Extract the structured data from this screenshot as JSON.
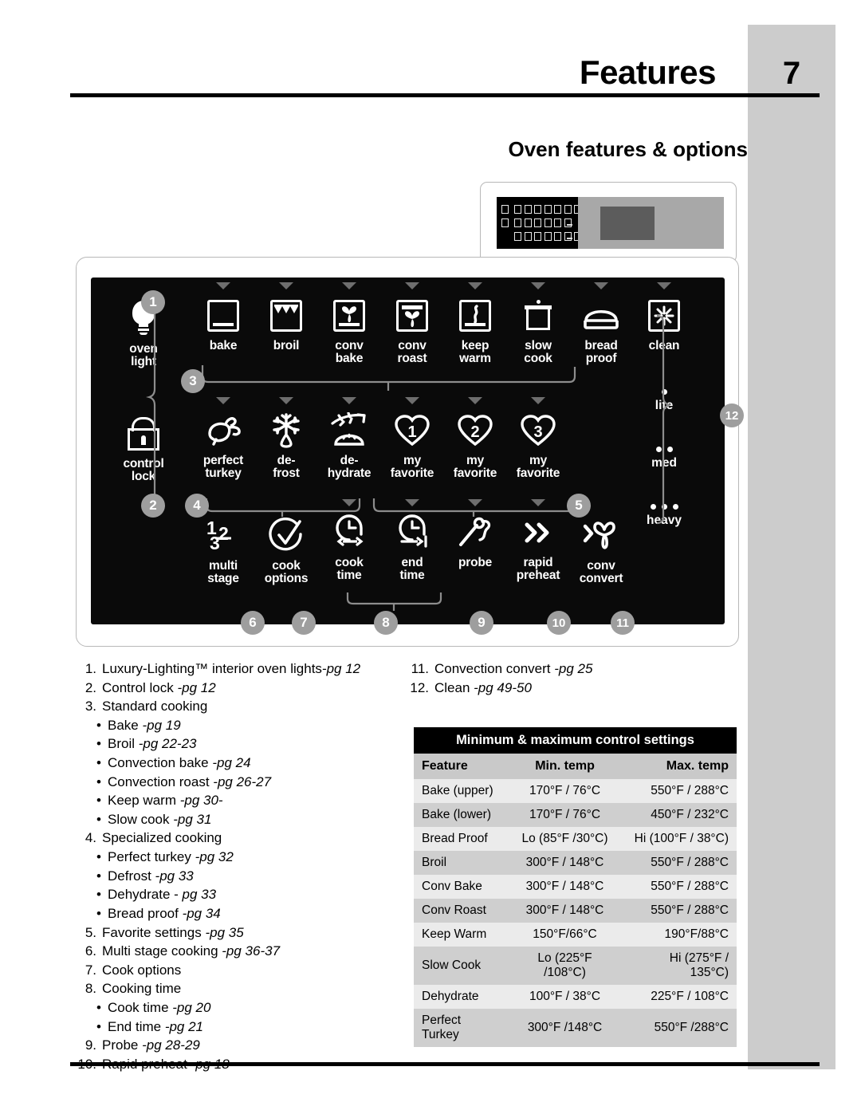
{
  "header": {
    "title": "Features",
    "page_number": "7",
    "section_title": "Oven features & options"
  },
  "panel": {
    "row1": [
      {
        "label_lines": [
          "oven",
          "light"
        ],
        "icon": "light-bulb-icon",
        "caret": false
      },
      {
        "label_lines": [
          "bake"
        ],
        "icon": "bake-oven-icon",
        "caret": true
      },
      {
        "label_lines": [
          "broil"
        ],
        "icon": "broil-element-icon",
        "caret": true
      },
      {
        "label_lines": [
          "conv",
          "bake"
        ],
        "icon": "convection-bake-fan-icon",
        "caret": true
      },
      {
        "label_lines": [
          "conv",
          "roast"
        ],
        "icon": "convection-roast-fan-icon",
        "caret": true
      },
      {
        "label_lines": [
          "keep",
          "warm"
        ],
        "icon": "keep-warm-steam-icon",
        "caret": true
      },
      {
        "label_lines": [
          "slow",
          "cook"
        ],
        "icon": "slow-cook-pot-icon",
        "caret": true
      },
      {
        "label_lines": [
          "bread",
          "proof"
        ],
        "icon": "bread-loaf-icon",
        "caret": true
      },
      {
        "label_lines": [
          "clean"
        ],
        "icon": "clean-starburst-icon",
        "caret": true
      }
    ],
    "row2": [
      {
        "label_lines": [
          "control",
          "lock"
        ],
        "icon": "padlock-icon",
        "caret": false
      },
      {
        "label_lines": [
          "perfect",
          "turkey"
        ],
        "icon": "turkey-icon",
        "caret": true
      },
      {
        "label_lines": [
          "de-",
          "frost"
        ],
        "icon": "snowflake-drop-icon",
        "caret": true
      },
      {
        "label_lines": [
          "de-",
          "hydrate"
        ],
        "icon": "dehydrate-icon",
        "caret": true
      },
      {
        "label_lines": [
          "my",
          "favorite"
        ],
        "icon": "heart-1-icon",
        "badge": "1",
        "caret": true
      },
      {
        "label_lines": [
          "my",
          "favorite"
        ],
        "icon": "heart-2-icon",
        "badge": "2",
        "caret": true
      },
      {
        "label_lines": [
          "my",
          "favorite"
        ],
        "icon": "heart-3-icon",
        "badge": "3",
        "caret": true
      }
    ],
    "row3": [
      {
        "label_lines": [
          "multi",
          "stage"
        ],
        "icon": "multi-stage-123-icon",
        "caret": false
      },
      {
        "label_lines": [
          "cook",
          "options"
        ],
        "icon": "cook-options-check-icon",
        "caret": false
      },
      {
        "label_lines": [
          "cook",
          "time"
        ],
        "icon": "cook-time-clock-icon",
        "caret": true
      },
      {
        "label_lines": [
          "end",
          "time"
        ],
        "icon": "end-time-clock-icon",
        "caret": true
      },
      {
        "label_lines": [
          "probe"
        ],
        "icon": "meat-probe-icon",
        "caret": true
      },
      {
        "label_lines": [
          "rapid",
          "preheat"
        ],
        "icon": "double-chevron-icon",
        "caret": true
      },
      {
        "label_lines": [
          "conv",
          "convert"
        ],
        "icon": "convection-convert-icon",
        "caret": false
      }
    ],
    "soil_levels": [
      {
        "label": "lite",
        "dots": 1
      },
      {
        "label": "med",
        "dots": 2
      },
      {
        "label": "heavy",
        "dots": 3
      }
    ],
    "callouts": [
      "1",
      "2",
      "3",
      "4",
      "5",
      "6",
      "7",
      "8",
      "9",
      "10",
      "11",
      "12"
    ]
  },
  "legend_left": [
    {
      "num": "1.",
      "text": "Luxury-Lighting™ interior oven lights",
      "pg": "-pg 12",
      "sub": false
    },
    {
      "num": "2.",
      "text": "Control lock ",
      "pg": "-pg 12",
      "sub": false
    },
    {
      "num": "3.",
      "text": "Standard cooking",
      "pg": "",
      "sub": false
    },
    {
      "num": "",
      "text": "Bake ",
      "pg": "-pg 19",
      "sub": true
    },
    {
      "num": "",
      "text": "Broil ",
      "pg": "-pg 22-23",
      "sub": true
    },
    {
      "num": "",
      "text": "Convection bake ",
      "pg": "-pg 24",
      "sub": true
    },
    {
      "num": "",
      "text": "Convection roast ",
      "pg": "-pg 26-27",
      "sub": true
    },
    {
      "num": "",
      "text": "Keep warm ",
      "pg": "-pg 30-",
      "sub": true
    },
    {
      "num": "",
      "text": "Slow cook ",
      "pg": "-pg 31",
      "sub": true
    },
    {
      "num": "4.",
      "text": "Specialized cooking",
      "pg": "",
      "sub": false
    },
    {
      "num": "",
      "text": "Perfect turkey ",
      "pg": "-pg 32",
      "sub": true
    },
    {
      "num": "",
      "text": "Defrost ",
      "pg": "-pg 33",
      "sub": true
    },
    {
      "num": "",
      "text": "Dehydrate - ",
      "pg": "pg 33",
      "sub": true
    },
    {
      "num": "",
      "text": "Bread proof  ",
      "pg": "-pg 34",
      "sub": true
    },
    {
      "num": "5.",
      "text": "Favorite settings ",
      "pg": "-pg 35",
      "sub": false
    },
    {
      "num": "6.",
      "text": "Multi stage cooking ",
      "pg": "-pg 36-37",
      "sub": false
    },
    {
      "num": "7.",
      "text": "Cook options",
      "pg": "",
      "sub": false
    },
    {
      "num": "8.",
      "text": "Cooking time",
      "pg": "",
      "sub": false
    },
    {
      "num": "",
      "text": "Cook time ",
      "pg": "-pg 20",
      "sub": true
    },
    {
      "num": "",
      "text": "End time ",
      "pg": "-pg 21",
      "sub": true
    },
    {
      "num": "9.",
      "text": "Probe ",
      "pg": "-pg 28-29",
      "sub": false
    },
    {
      "num": "10.",
      "text": "Rapid preheat ",
      "pg": "-pg 18",
      "sub": false
    }
  ],
  "legend_right": [
    {
      "num": "11.",
      "text": "Convection convert ",
      "pg": "-pg 25",
      "sub": false
    },
    {
      "num": "12.",
      "text": "Clean ",
      "pg": "-pg 49-50",
      "sub": false
    }
  ],
  "table": {
    "caption": "Minimum & maximum control settings",
    "columns": [
      "Feature",
      "Min. temp",
      "Max. temp"
    ],
    "rows": [
      [
        "Bake (upper)",
        "170°F / 76°C",
        "550°F / 288°C"
      ],
      [
        "Bake (lower)",
        "170°F / 76°C",
        "450°F / 232°C"
      ],
      [
        "Bread Proof",
        "Lo (85°F /30°C)",
        "Hi (100°F / 38°C)"
      ],
      [
        "Broil",
        "300°F / 148°C",
        "550°F / 288°C"
      ],
      [
        "Conv Bake",
        "300°F / 148°C",
        "550°F / 288°C"
      ],
      [
        "Conv Roast",
        "300°F / 148°C",
        "550°F / 288°C"
      ],
      [
        "Keep  Warm",
        "150°F/66°C",
        "190°F/88°C"
      ],
      [
        "Slow Cook",
        "Lo (225°F /108°C)",
        "Hi (275°F / 135°C)"
      ],
      [
        "Dehydrate",
        "100°F / 38°C",
        "225°F / 108°C"
      ],
      [
        "Perfect Turkey",
        "300°F /148°C",
        "550°F /288°C"
      ]
    ]
  },
  "colors": {
    "panel_black": "#0a0a0a",
    "tab_gray": "#cccccc",
    "bubble_gray": "#9e9e9e",
    "row_light": "#ebebeb",
    "row_dark": "#cfcfcf"
  }
}
